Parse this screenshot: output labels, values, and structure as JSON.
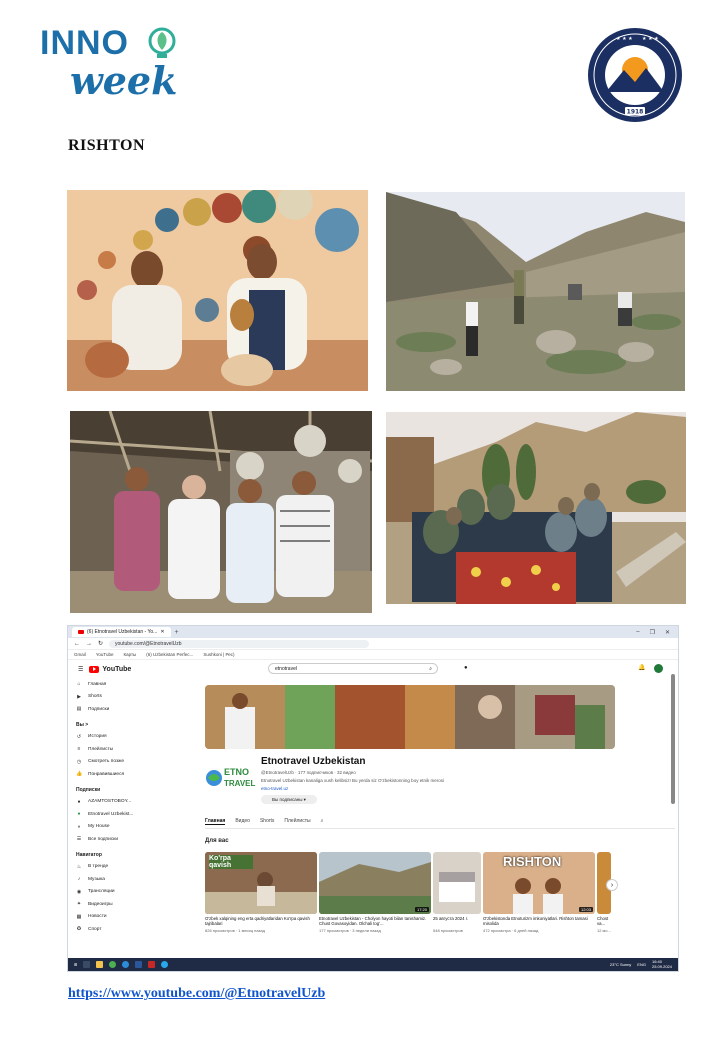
{
  "header": {
    "logo_top": "INNO",
    "logo_bottom": "week",
    "seal_year": "1918"
  },
  "page_title": "RISHTON",
  "browser": {
    "tab_label": "(6) Etnotravel Uzbekistan - Yo...",
    "url": "youtube.com/@EtnotravelUzb",
    "bookmarks": [
      "Gmail",
      "YouTube",
      "Карты",
      "(6) Uzbekistan Perfec...",
      "Sushkoni | Рес)"
    ],
    "window_controls": [
      "–",
      "❐",
      "✕"
    ]
  },
  "youtube": {
    "logo_text": "YouTube",
    "search_value": "etnotravel",
    "sidebar_main": [
      {
        "icon": "home-icon",
        "label": "Главная"
      },
      {
        "icon": "shorts-icon",
        "label": "Shorts"
      },
      {
        "icon": "subscriptions-icon",
        "label": "Подписки"
      }
    ],
    "sidebar_you_head": "Вы  >",
    "sidebar_you": [
      {
        "icon": "history-icon",
        "label": "История"
      },
      {
        "icon": "playlist-icon",
        "label": "Плейлисты"
      },
      {
        "icon": "clock-icon",
        "label": "Смотреть позже"
      },
      {
        "icon": "like-icon",
        "label": "Понравившиеся"
      }
    ],
    "sidebar_subs_head": "Подписки",
    "sidebar_subs": [
      {
        "icon": "avatar-icon",
        "label": "AZAMTOSTOBOY..."
      },
      {
        "icon": "avatar-icon",
        "label": "Etnotravel Uzbekist..."
      },
      {
        "icon": "avatar-icon",
        "label": "My House"
      },
      {
        "icon": "list-icon",
        "label": "Все подписки"
      }
    ],
    "sidebar_nav_head": "Навигатор",
    "sidebar_nav": [
      {
        "icon": "trending-icon",
        "label": "В тренде"
      },
      {
        "icon": "music-icon",
        "label": "Музыка"
      },
      {
        "icon": "live-icon",
        "label": "Трансляции"
      },
      {
        "icon": "games-icon",
        "label": "Видеоигры"
      },
      {
        "icon": "news-icon",
        "label": "Новости"
      },
      {
        "icon": "sport-icon",
        "label": "Спорт"
      }
    ],
    "channel": {
      "logo_text_1": "ETNO",
      "logo_text_2": "TRAVEL",
      "name": "Etnotravel Uzbekistan",
      "meta": "@EtnotravelUzb · 177 подписчиков · 32 видео",
      "description": "Etnotravel Uzbekistan kanaliga xush kelibsiz! Bu yerda siz O'zbekistonning boy etnik merosi",
      "link": "etno-travel.uz",
      "subscribe_label": "Вы подписаны ▾"
    },
    "tabs": [
      "Главная",
      "Видео",
      "Shorts",
      "Плейлисты"
    ],
    "section_title": "Для вас",
    "videos": [
      {
        "title": "O'zbek xalqining eng erta qadriyatlaridan Ko'rpa qavish tajribalari",
        "meta": "826 просмотров · 1 месяц назад",
        "overlay": "Ko'rpa qavish",
        "duration": ""
      },
      {
        "title": "Etnotravel Uzbekistan - Cholyon hayoti bilan tanishamiz. Chust Govasoyidan. Olchali tog'...",
        "meta": "177 просмотров · 3 недели назад",
        "overlay": "",
        "duration": "17:20"
      },
      {
        "title": "25 августа 2024 г.",
        "meta": "548 просмотров",
        "overlay": "",
        "duration": ""
      },
      {
        "title": "O'zbekistonda Etnoturizm imkoniyatlari. Rishton tamasi misolida",
        "meta": "472 просмотра · 6 дней назад",
        "overlay": "RISHTON",
        "duration": "12:03"
      },
      {
        "title": "Chost va...",
        "meta": "12 мо...",
        "overlay": "",
        "duration": ""
      }
    ],
    "taskbar": {
      "weather": "23°C Sunny",
      "lang": "ENG",
      "time": "16:40",
      "date": "25.09.2024"
    }
  },
  "external_link": "https://www.youtube.com/@EtnotravelUzb"
}
